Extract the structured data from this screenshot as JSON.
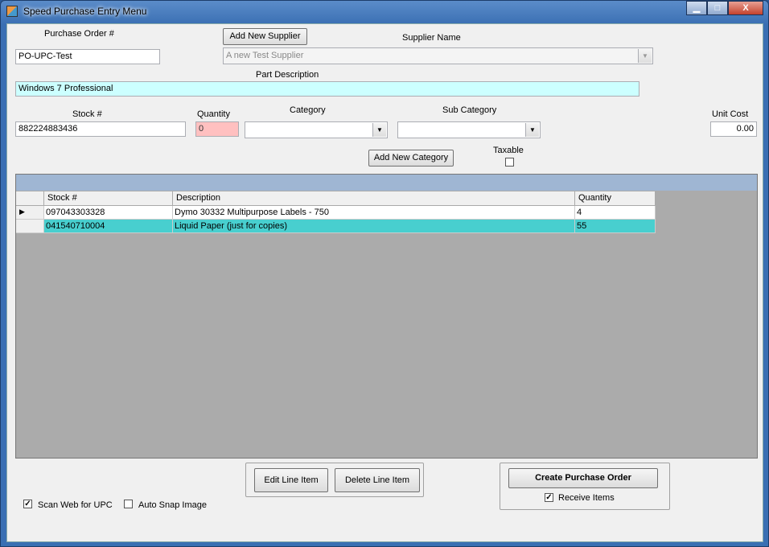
{
  "window": {
    "title": "Speed Purchase Entry Menu",
    "minimize": "▁",
    "maximize": "□",
    "close": "X"
  },
  "form": {
    "po_label": "Purchase Order #",
    "po_value": "PO-UPC-Test",
    "add_supplier": "Add New Supplier",
    "supplier_label": "Supplier Name",
    "supplier_value": "A new Test Supplier",
    "part_desc_label": "Part Description",
    "part_desc_value": "Windows 7 Professional",
    "stock_label": "Stock #",
    "stock_value": "882224883436",
    "qty_label": "Quantity",
    "qty_value": "0",
    "category_label": "Category",
    "category_value": "",
    "subcategory_label": "Sub Category",
    "subcategory_value": "",
    "unit_cost_label": "Unit Cost",
    "unit_cost_value": "0.00",
    "add_category": "Add New Category",
    "taxable_label": "Taxable",
    "taxable_checked": false
  },
  "grid": {
    "columns": [
      "Stock #",
      "Description",
      "Quantity"
    ],
    "rows": [
      {
        "stock": "097043303328",
        "description": "Dymo 30332 Multipurpose Labels - 750",
        "quantity": "4"
      },
      {
        "stock": "041540710004",
        "description": "Liquid Paper (just for copies)",
        "quantity": "55"
      }
    ],
    "current_row_marker": "▶",
    "selected_row_color": "#48cfcf"
  },
  "actions": {
    "edit_line": "Edit Line Item",
    "delete_line": "Delete Line Item",
    "create_po": "Create Purchase Order",
    "receive_items": "Receive Items",
    "receive_items_checked": true,
    "scan_web": "Scan Web for UPC",
    "scan_web_checked": true,
    "auto_snap": "Auto Snap Image",
    "auto_snap_checked": false
  },
  "colors": {
    "highlight_field": "#ccffff",
    "quantity_field": "#ffc0c0",
    "grid_header": "#9fb6d3"
  }
}
